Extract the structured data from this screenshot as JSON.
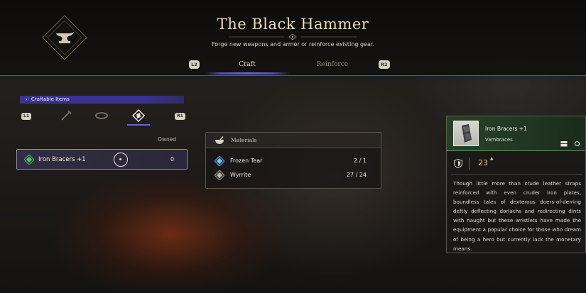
{
  "header": {
    "title": "The Black Hammer",
    "subtitle": "Forge new weapons and armor or reinforce existing gear.",
    "emblem_icon": "anvil-icon"
  },
  "tabs": [
    {
      "label": "Craft",
      "active": true
    },
    {
      "label": "Reinforce",
      "active": false
    }
  ],
  "hints": {
    "tab_prev": "L2",
    "tab_next": "R2",
    "cat_prev": "L1",
    "cat_next": "R1"
  },
  "category": {
    "label": "Craftable Items",
    "icons": [
      "sword-icon",
      "ring-icon",
      "bracer-icon"
    ],
    "active_index": 2
  },
  "item_list": {
    "owned_header": "Owned",
    "items": [
      {
        "name": "Iron Bracers +1",
        "owned": "0",
        "icon": "green-gem-icon",
        "selected": true
      }
    ]
  },
  "materials": {
    "title": "Materials",
    "icon": "mortar-bowl-icon",
    "rows": [
      {
        "name": "Frozen Tear",
        "count": "2 / 1",
        "icon": "blue-gem-icon"
      },
      {
        "name": "Wyrrite",
        "count": "27 / 24",
        "icon": "grey-gem-icon"
      }
    ]
  },
  "detail": {
    "name": "Iron Bracers +1",
    "type": "Vambraces",
    "stat_value": "23",
    "stat_icon": "shield-icon",
    "description": "Though little more than crude leather straps reinforced with even cruder iron plates, boundless tales of dexterous doers-of-derring deftly deflecting dorlachs and redirecting dints with naught but these wristlets have made the equipment a popular choice for those who dream of being a hero but currently lack the monetary means."
  },
  "colors": {
    "accent_purple": "#3b3392",
    "gold_title": "#e9dcb8",
    "stat_gold": "#e8c96a",
    "detail_green": "#28462a"
  }
}
